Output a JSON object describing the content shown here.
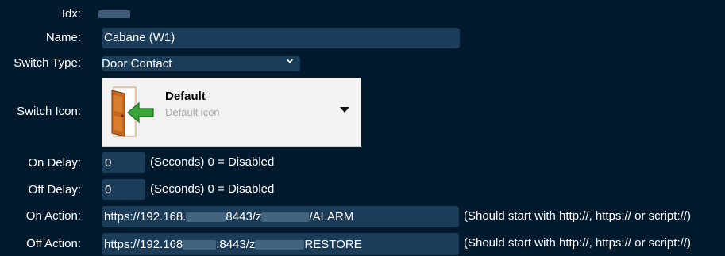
{
  "form": {
    "idx_label": "Idx:",
    "name_label": "Name:",
    "name_value": "Cabane (W1)",
    "switch_type_label": "Switch Type:",
    "switch_type_value": "Door Contact",
    "switch_icon_label": "Switch Icon:",
    "icon_title": "Default",
    "icon_subtitle": "Default icon",
    "on_delay_label": "On Delay:",
    "on_delay_value": "0",
    "on_delay_hint": "(Seconds) 0 = Disabled",
    "off_delay_label": "Off Delay:",
    "off_delay_value": "0",
    "off_delay_hint": "(Seconds) 0 = Disabled",
    "on_action_label": "On Action:",
    "on_action_part1": "https://192.168.",
    "on_action_part2": "8443/z",
    "on_action_part3": "/ALARM",
    "on_action_hint": "(Should start with http://, https:// or script://)",
    "off_action_label": "Off Action:",
    "off_action_part1": "https://192.168",
    "off_action_part2": ":8443/z",
    "off_action_part3": "RESTORE",
    "off_action_hint": "(Should start with http://, https:// or script://)"
  },
  "icons": {
    "switch_type_dropdown": "chevron-down-icon",
    "icon_dropdown": "caret-down-icon",
    "switch_icon": "door-contact-icon"
  },
  "colors": {
    "background": "#021a2e",
    "field_bg": "#1c3d5a",
    "icon_panel_bg": "#f2f2f2",
    "arrow_green": "#3aa53a"
  }
}
